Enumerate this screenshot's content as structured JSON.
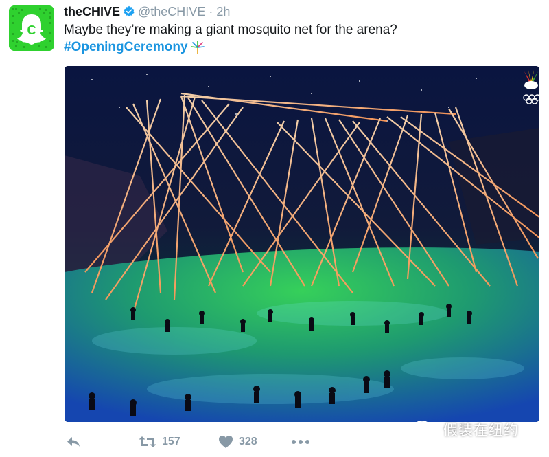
{
  "tweet": {
    "author_name": "theCHIVE",
    "handle": "@theCHIVE",
    "separator": "·",
    "time": "2h",
    "text": "Maybe they’re making a giant mosquito net for the arena?",
    "hashtag": "#OpeningCeremony",
    "verified": true
  },
  "avatar": {
    "letter": "C",
    "color": "#2fd12f",
    "icon": "snapcode-ghost"
  },
  "media": {
    "overlay_icons": [
      "nbc-peacock-icon",
      "olympic-rings-icon"
    ]
  },
  "actions": {
    "reply_icon": "reply-icon",
    "retweet_icon": "retweet-icon",
    "retweet_count": "157",
    "like_icon": "heart-icon",
    "like_count": "328",
    "more_icon": "more-dots-icon"
  },
  "watermark": {
    "icon": "wechat-icon",
    "text": "假装在纽约"
  },
  "colors": {
    "link": "#1b95e0",
    "muted": "#8899a6",
    "verified": "#1da1f2"
  }
}
